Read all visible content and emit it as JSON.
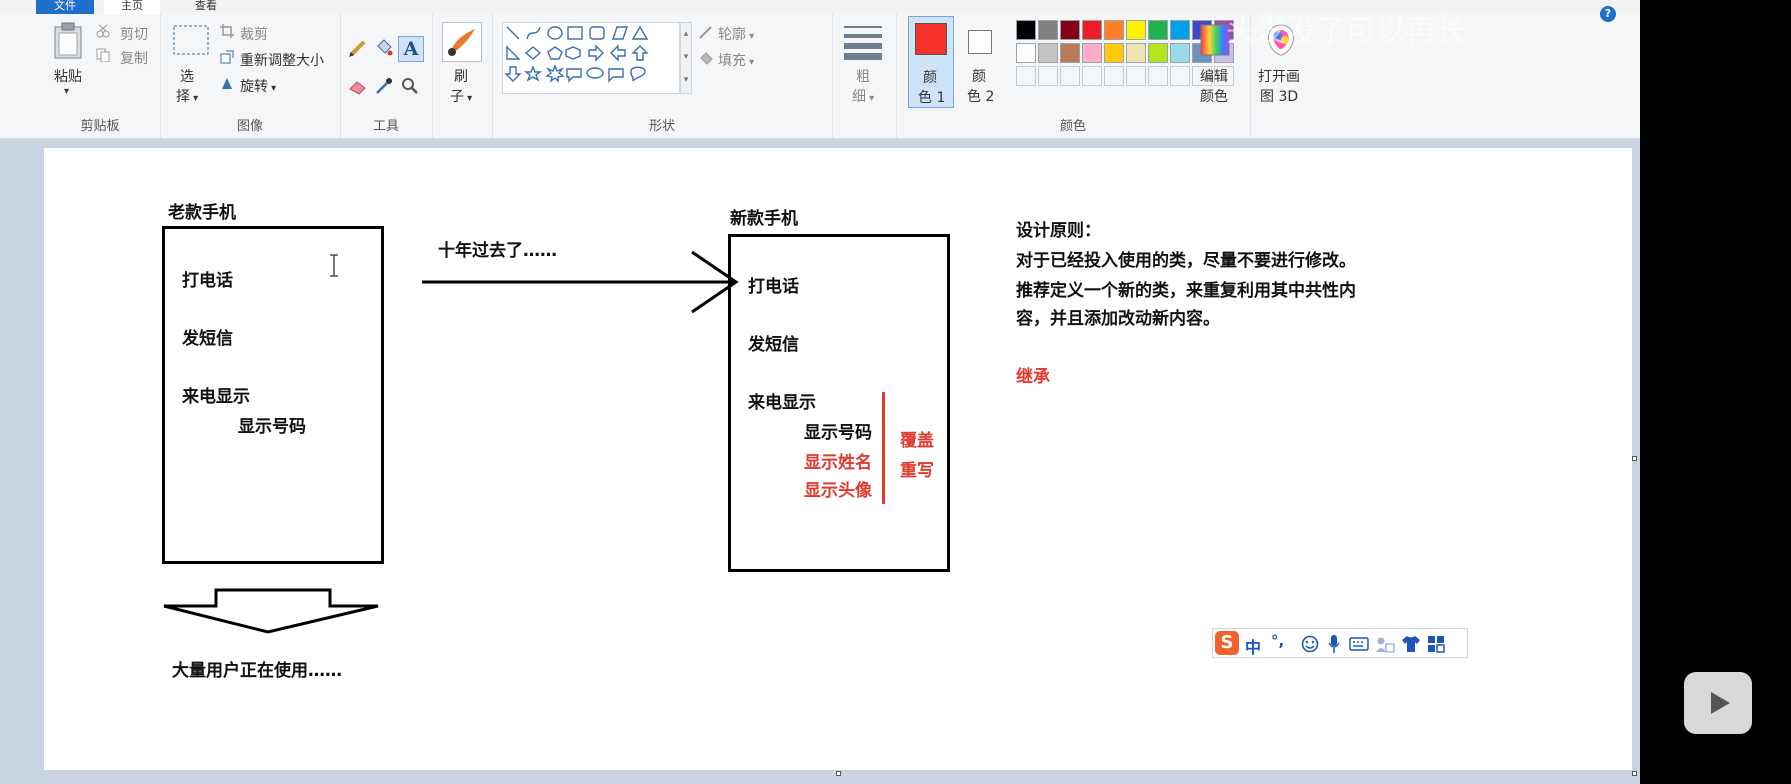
{
  "tabs": {
    "file": "文件",
    "home": "主页",
    "view": "查看"
  },
  "clipboard": {
    "paste": "粘贴",
    "cut": "剪切",
    "copy": "复制",
    "label": "剪贴板"
  },
  "image": {
    "select_line1": "选",
    "select_line2": "择",
    "crop": "裁剪",
    "resize": "重新调整大小",
    "rotate": "旋转",
    "label": "图像"
  },
  "tools": {
    "label": "工具"
  },
  "brush": {
    "line1": "刷",
    "line2": "子"
  },
  "shapes": {
    "outline": "轮廓",
    "fill": "填充",
    "label": "形状"
  },
  "size": {
    "line1": "粗",
    "line2": "细"
  },
  "colors": {
    "color1_line1": "颜",
    "color1_line2": "色 1",
    "color2_line1": "颜",
    "color2_line2": "色 2",
    "edit_line1": "编辑",
    "edit_line2": "颜色",
    "label": "颜色",
    "color1_value": "#f5322a",
    "color2_value": "#ffffff",
    "palette_row1": [
      "#000000",
      "#7f7f7f",
      "#880015",
      "#ed1c24",
      "#ff7f27",
      "#fff200",
      "#22b14c",
      "#00a2e8",
      "#3f48cc",
      "#a349a4"
    ],
    "palette_row2": [
      "#ffffff",
      "#c3c3c3",
      "#b97a57",
      "#ffaec9",
      "#ffc90e",
      "#efe4b0",
      "#b5e61d",
      "#99d9ea",
      "#7092be",
      "#c8bfe7"
    ]
  },
  "paint3d": {
    "line1": "打开画",
    "line2": "图 3D"
  },
  "watermark": "头发没了可以再长",
  "drawing": {
    "old_phone_title": "老款手机",
    "old_items": [
      "打电话",
      "发短信",
      "来电显示",
      "显示号码"
    ],
    "arrow_caption": "十年过去了……",
    "new_phone_title": "新款手机",
    "new_items": [
      "打电话",
      "发短信",
      "来电显示",
      "显示号码"
    ],
    "new_red_items": [
      "显示姓名",
      "显示头像"
    ],
    "override_labels": [
      "覆盖",
      "重写"
    ],
    "principle_title": "设计原则：",
    "principle_lines": [
      "对于已经投入使用的类，尽量不要进行修改。",
      "推荐定义一个新的类，来重复利用其中共性内",
      "容，并且添加改动新内容。"
    ],
    "inherit": "继承",
    "users_caption": "大量用户正在使用……"
  },
  "ime": {
    "mode": "中",
    "punct": "°,"
  }
}
